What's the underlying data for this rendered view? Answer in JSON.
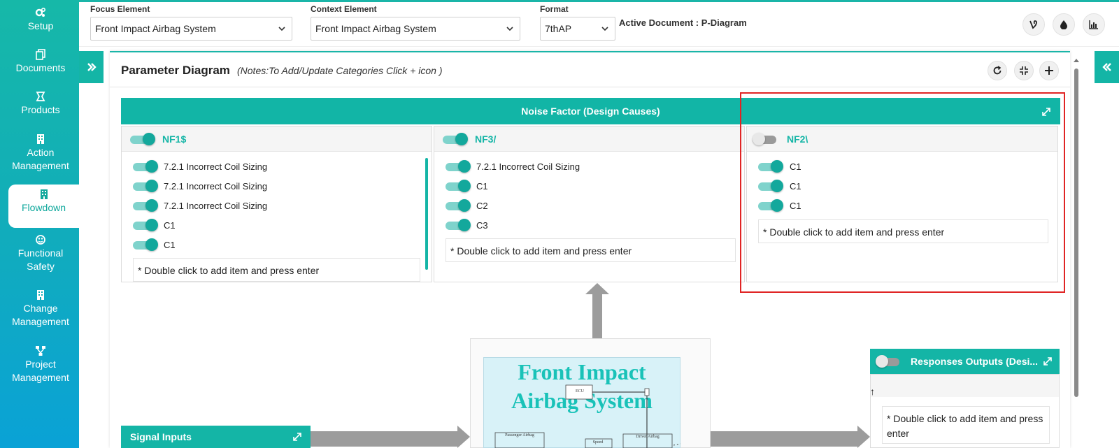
{
  "sidebar": {
    "items": [
      {
        "label": "Setup",
        "icon": "gears-icon"
      },
      {
        "label": "Documents",
        "icon": "documents-icon"
      },
      {
        "label": "Products",
        "icon": "products-icon"
      },
      {
        "label": "Action Management",
        "icon": "building-icon"
      },
      {
        "label": "Flowdown",
        "icon": "building-icon",
        "active": true
      },
      {
        "label": "Functional Safety",
        "icon": "safety-icon"
      },
      {
        "label": "Change Management",
        "icon": "building-icon"
      },
      {
        "label": "Project Management",
        "icon": "sitemap-icon"
      }
    ]
  },
  "header": {
    "focus_label": "Focus Element",
    "focus_value": "Front Impact Airbag System",
    "context_label": "Context Element",
    "context_value": "Front Impact Airbag System",
    "format_label": "Format",
    "format_value": "7thAP",
    "active_document": "Active Document : P-Diagram",
    "icons": [
      "vine-icon",
      "drop-icon",
      "chart-icon"
    ]
  },
  "panel": {
    "title": "Parameter Diagram",
    "note": "(Notes:To Add/Update Categories Click + icon )",
    "tools": [
      "refresh-icon",
      "compress-icon",
      "plus-icon"
    ]
  },
  "noise_factor": {
    "title": "Noise Factor (Design Causes)",
    "columns": [
      {
        "title": "NF1$",
        "enabled": true,
        "items": [
          "7.2.1 Incorrect Coil Sizing",
          "7.2.1 Incorrect Coil Sizing",
          "7.2.1 Incorrect Coil Sizing",
          "C1",
          "C1"
        ],
        "add_placeholder": "* Double click to add item and press enter"
      },
      {
        "title": "NF3/",
        "enabled": true,
        "items": [
          "7.2.1 Incorrect Coil Sizing",
          "C1",
          "C2",
          "C3"
        ],
        "add_placeholder": "* Double click to add item and press enter"
      },
      {
        "title": "NF2\\",
        "enabled": false,
        "items": [
          "C1",
          "C1",
          "C1"
        ],
        "add_placeholder": "* Double click to add item and press enter"
      }
    ]
  },
  "center": {
    "title": "Front Impact Airbag System",
    "labels": [
      "ECU",
      "Passenger Airbag",
      "Speed",
      "Driver Airbag"
    ]
  },
  "responses": {
    "title": "Responses Outputs (Desi...",
    "enabled": false,
    "sort_glyph": "↑",
    "add_placeholder": "* Double click to add item and press enter"
  },
  "signal": {
    "title": "Signal Inputs"
  },
  "colors": {
    "accent": "#14b5a6",
    "highlight": "#e02424"
  }
}
